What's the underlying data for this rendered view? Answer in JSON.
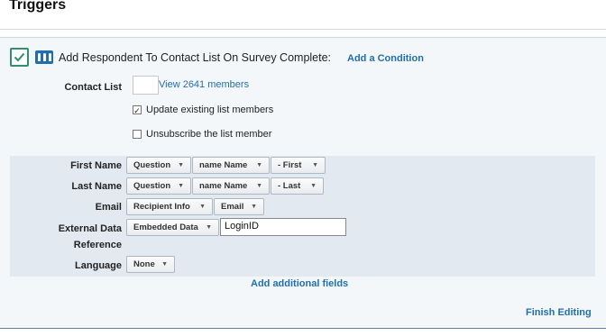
{
  "page": {
    "title": "Triggers"
  },
  "trigger": {
    "action_title": "Add Respondent To Contact List On Survey Complete:",
    "add_condition": "Add a Condition",
    "contact_list_label": "Contact List",
    "view_members": "View 2641 members",
    "options": [
      {
        "label": "Update existing list members",
        "checked": true,
        "mark": "✓"
      },
      {
        "label": "Unsubscribe the list member",
        "checked": false,
        "mark": ""
      }
    ],
    "fields": {
      "first_name": {
        "label": "First Name",
        "selects": [
          "Question",
          "name Name",
          "- First"
        ]
      },
      "last_name": {
        "label": "Last Name",
        "selects": [
          "Question",
          "name Name",
          "- Last"
        ]
      },
      "email": {
        "label": "Email",
        "selects": [
          "Recipient Info",
          "Email"
        ]
      },
      "external_ref": {
        "label_line1": "External Data",
        "label_line2": "Reference",
        "selects": [
          "Embedded Data"
        ],
        "value": "LoginID"
      },
      "language": {
        "label": "Language",
        "selects": [
          "None"
        ]
      }
    },
    "add_fields": "Add additional fields",
    "finish": "Finish Editing"
  },
  "icons": {
    "check": "checkmark-icon",
    "people": "people-icon",
    "caret": "caret-down-icon"
  },
  "colors": {
    "link": "#1f6fb0",
    "check": "#2f8f6f",
    "panel_bg": "#f4f7fa",
    "fields_bg": "#e2e9f1"
  }
}
